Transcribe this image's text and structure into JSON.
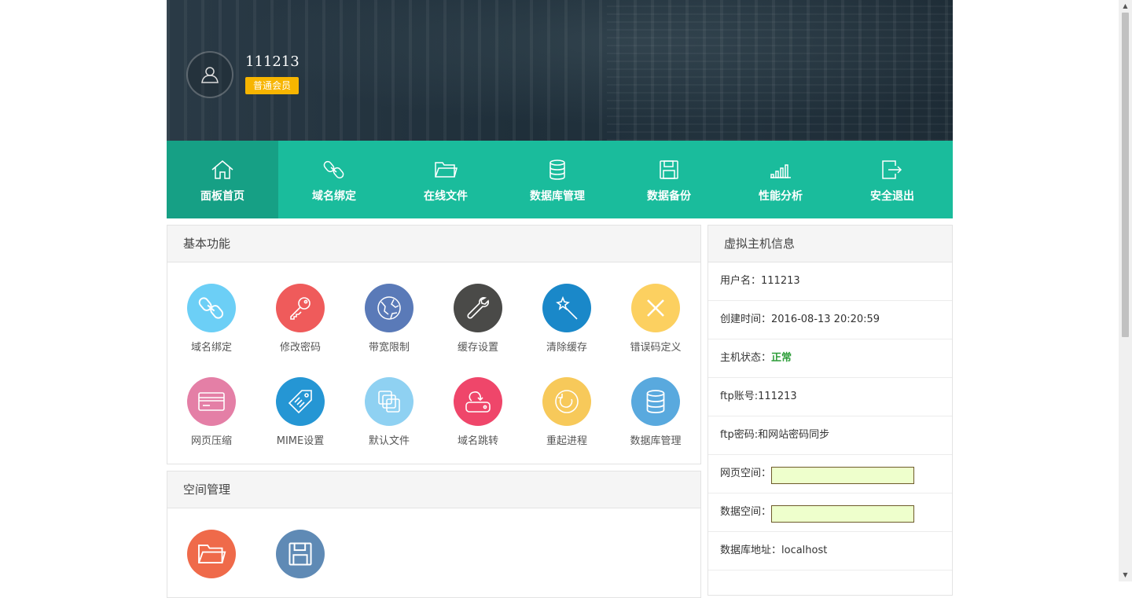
{
  "user": {
    "name": "111213",
    "level": "普通会员"
  },
  "nav": [
    {
      "label": "面板首页",
      "icon": "home-icon",
      "active": true
    },
    {
      "label": "域名绑定",
      "icon": "link-icon"
    },
    {
      "label": "在线文件",
      "icon": "folder-icon"
    },
    {
      "label": "数据库管理",
      "icon": "database-icon"
    },
    {
      "label": "数据备份",
      "icon": "save-icon"
    },
    {
      "label": "性能分析",
      "icon": "signal-icon"
    },
    {
      "label": "安全退出",
      "icon": "logout-icon"
    }
  ],
  "basic": {
    "title": "基本功能",
    "items": [
      {
        "label": "域名绑定",
        "icon": "link-icon",
        "color": "#6ccff6"
      },
      {
        "label": "修改密码",
        "icon": "key-icon",
        "color": "#ef5b5b"
      },
      {
        "label": "带宽限制",
        "icon": "globe-icon",
        "color": "#5a7ab8"
      },
      {
        "label": "缓存设置",
        "icon": "wrench-icon",
        "color": "#4a4a48"
      },
      {
        "label": "清除缓存",
        "icon": "magic-wand-icon",
        "color": "#1a88c9"
      },
      {
        "label": "错误码定义",
        "icon": "close-icon",
        "color": "#fcd060"
      },
      {
        "label": "网页压缩",
        "icon": "card-icon",
        "color": "#e47fa6"
      },
      {
        "label": "MIME设置",
        "icon": "tag-icon",
        "color": "#2596d4"
      },
      {
        "label": "默认文件",
        "icon": "files-icon",
        "color": "#8fd1f2"
      },
      {
        "label": "域名跳转",
        "icon": "redirect-icon",
        "color": "#ef466a"
      },
      {
        "label": "重起进程",
        "icon": "refresh-icon",
        "color": "#f7c95a"
      },
      {
        "label": "数据库管理",
        "icon": "database-icon",
        "color": "#59a9de"
      }
    ]
  },
  "space": {
    "title": "空间管理",
    "items": [
      {
        "icon": "folder-icon",
        "color": "#ef6a4a"
      },
      {
        "icon": "save-icon",
        "color": "#5f8ab5"
      }
    ]
  },
  "hostinfo": {
    "title": "虚拟主机信息",
    "username": "用户名：111213",
    "created": "创建时间：2016-08-13 20:20:59",
    "status_label": "主机状态：",
    "status_value": "正常",
    "ftp_user": "ftp账号:111213",
    "ftp_pass": "ftp密码:和网站密码同步",
    "web_space": "网页空间：",
    "db_space": "数据空间：",
    "db_host": "数据库地址：localhost"
  }
}
